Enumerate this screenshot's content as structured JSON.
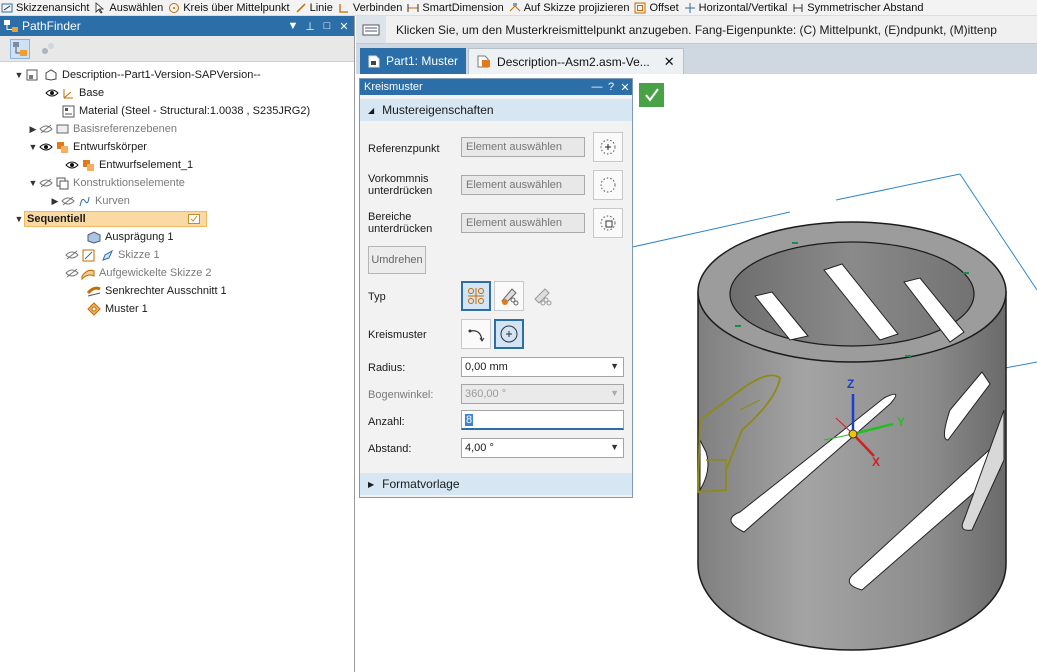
{
  "command_bar": {
    "items": [
      {
        "label": "Skizzenansicht",
        "icon": "sketch-view-icon"
      },
      {
        "label": "Auswählen",
        "icon": "select-arrow-icon"
      },
      {
        "label": "Kreis über Mittelpunkt",
        "icon": "circle-center-icon"
      },
      {
        "label": "Linie",
        "icon": "line-icon"
      },
      {
        "label": "Verbinden",
        "icon": "connect-icon"
      },
      {
        "label": "SmartDimension",
        "icon": "smart-dimension-icon"
      },
      {
        "label": "Auf Skizze projizieren",
        "icon": "project-sketch-icon"
      },
      {
        "label": "Offset",
        "icon": "offset-icon"
      },
      {
        "label": "Horizontal/Vertikal",
        "icon": "horizontal-vertical-icon"
      },
      {
        "label": "Symmetrischer Abstand",
        "icon": "symmetric-distance-icon"
      }
    ]
  },
  "pathfinder": {
    "title": "PathFinder",
    "tree": [
      {
        "label": "Description--Part1-Version-SAPVersion--"
      },
      {
        "label": "Base"
      },
      {
        "label": "Material (Steel - Structural:1.0038 , S235JRG2)"
      },
      {
        "label": "Basisreferenzebenen"
      },
      {
        "label": "Entwurfskörper"
      },
      {
        "label": "Entwurfselement_1"
      },
      {
        "label": "Konstruktionselemente"
      },
      {
        "label": "Kurven"
      },
      {
        "label": "Sequentiell"
      },
      {
        "label": "Ausprägung 1"
      },
      {
        "label": "Skizze 1"
      },
      {
        "label": "Aufgewickelte Skizze 2"
      },
      {
        "label": "Senkrechter Ausschnitt 1"
      },
      {
        "label": "Muster 1"
      }
    ]
  },
  "prompt_bar": {
    "text": "Klicken Sie, um den Musterkreismittelpunkt anzugeben. Fang-Eigenpunkte: (C) Mittelpunkt, (E)ndpunkt, (M)ittenp"
  },
  "tabs": [
    {
      "label": "Part1: Muster",
      "active": true
    },
    {
      "label": "Description--Asm2.asm-Ve...",
      "active": false
    }
  ],
  "dialog": {
    "title": "Kreismuster",
    "section_props": "Mustereigenschaften",
    "section_format": "Formatvorlage",
    "referenzpunkt_label": "Referenzpunkt",
    "vorkommnis_label": "Vorkommnis unterdrücken",
    "bereiche_label": "Bereiche unterdrücken",
    "element_placeholder": "Element auswählen",
    "umdrehen_label": "Umdrehen",
    "typ_label": "Typ",
    "kreismuster_label": "Kreismuster",
    "radius_label": "Radius:",
    "radius_value": "0,00 mm",
    "bogenwinkel_label": "Bogenwinkel:",
    "bogenwinkel_value": "360,00 °",
    "anzahl_label": "Anzahl:",
    "anzahl_value": "8",
    "abstand_label": "Abstand:",
    "abstand_value": "4,00 °"
  },
  "triad": {
    "z": "Z",
    "y": "Y",
    "x": "X"
  },
  "colors": {
    "accent": "#2b6ea8",
    "ok_green": "#49a346",
    "selection": "#fbd9a2",
    "part": "#9a9a9a"
  }
}
